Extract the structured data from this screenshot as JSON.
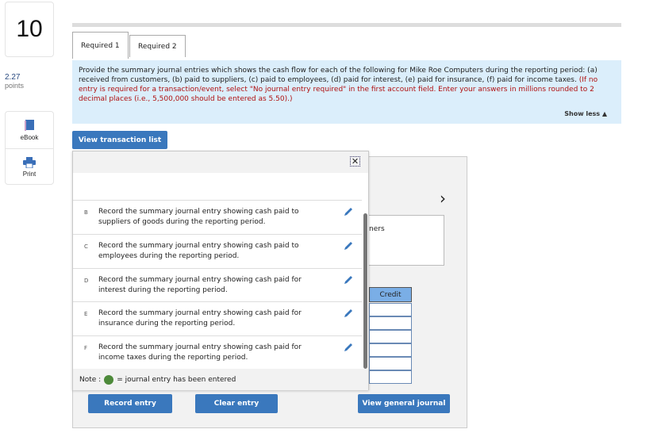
{
  "question": {
    "number": "10",
    "points_value": "2.27",
    "points_label": "points"
  },
  "tools": [
    {
      "label": "eBook",
      "icon": "book-icon"
    },
    {
      "label": "Print",
      "icon": "printer-icon"
    }
  ],
  "tabs": [
    {
      "label": "Required 1",
      "active": true
    },
    {
      "label": "Required 2",
      "active": false
    }
  ],
  "instructions": {
    "main": "Provide the summary journal entries which shows the cash flow for each of the following for Mike Roe Computers during the reporting period: (a) received from customers, (b) paid to suppliers, (c) paid to employees, (d) paid for interest, (e) paid for insurance, (f) paid for income taxes.",
    "note": "(If no entry is required for a transaction/event, select \"No journal entry required\" in the first account field. Enter your answers in millions rounded to 2 decimal places (i.e., 5,500,000 should be entered as 5.50).)",
    "show_less": "Show less ▲"
  },
  "view_transaction_list": "View transaction list",
  "popup": {
    "close": "✕",
    "items": [
      {
        "letter": "B",
        "text": "Record the summary journal entry showing cash paid to suppliers of goods during the reporting period."
      },
      {
        "letter": "C",
        "text": "Record the summary journal entry showing cash paid to employees during the reporting period."
      },
      {
        "letter": "D",
        "text": "Record the summary journal entry showing cash paid for interest during the reporting period."
      },
      {
        "letter": "E",
        "text": "Record the summary journal entry showing cash paid for insurance during the reporting period."
      },
      {
        "letter": "F",
        "text": "Record the summary journal entry showing cash paid for income taxes during the reporting period."
      }
    ],
    "note_prefix": "Note :",
    "note_suffix": "= journal entry has been entered"
  },
  "panel": {
    "partial_text": "ners",
    "credit_header": "Credit",
    "next": "›"
  },
  "buttons": {
    "record": "Record entry",
    "clear": "Clear entry",
    "view_journal": "View general journal"
  },
  "colors": {
    "accent": "#3a78bd",
    "instructions_bg": "#dbeefb",
    "entered_dot": "#4d8a3a",
    "warning_text": "#b01010"
  }
}
